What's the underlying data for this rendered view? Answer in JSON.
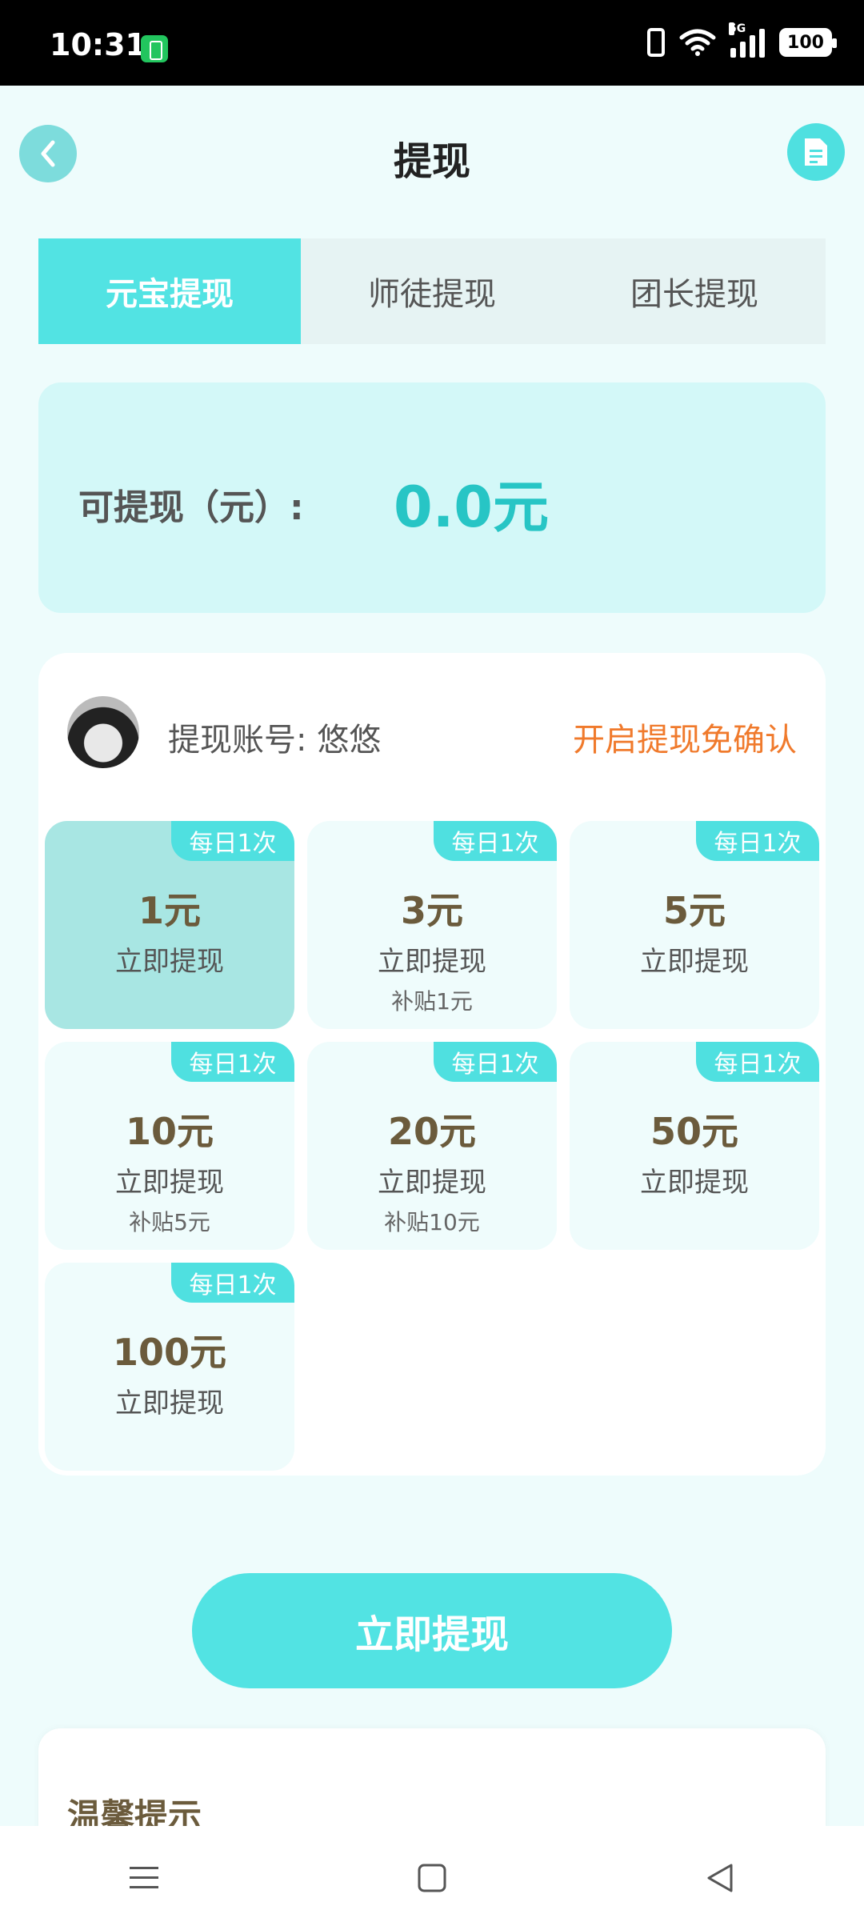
{
  "status_bar": {
    "time": "10:31",
    "network": "5G",
    "battery": "100"
  },
  "header": {
    "title": "提现"
  },
  "tabs": [
    {
      "label": "元宝提现",
      "active": true
    },
    {
      "label": "师徒提现",
      "active": false
    },
    {
      "label": "团长提现",
      "active": false
    }
  ],
  "balance": {
    "label": "可提现（元）:",
    "value": "0.0元"
  },
  "account": {
    "label": "提现账号: 悠悠",
    "auto_confirm_link": "开启提现免确认"
  },
  "amount_options": [
    {
      "badge": "每日1次",
      "amount": "1元",
      "action": "立即提现",
      "subsidy": "",
      "selected": true
    },
    {
      "badge": "每日1次",
      "amount": "3元",
      "action": "立即提现",
      "subsidy": "补贴1元",
      "selected": false
    },
    {
      "badge": "每日1次",
      "amount": "5元",
      "action": "立即提现",
      "subsidy": "",
      "selected": false
    },
    {
      "badge": "每日1次",
      "amount": "10元",
      "action": "立即提现",
      "subsidy": "补贴5元",
      "selected": false
    },
    {
      "badge": "每日1次",
      "amount": "20元",
      "action": "立即提现",
      "subsidy": "补贴10元",
      "selected": false
    },
    {
      "badge": "每日1次",
      "amount": "50元",
      "action": "立即提现",
      "subsidy": "",
      "selected": false
    },
    {
      "badge": "每日1次",
      "amount": "100元",
      "action": "立即提现",
      "subsidy": "",
      "selected": false
    }
  ],
  "withdraw_button": {
    "label": "立即提现"
  },
  "tips": {
    "title": "温馨提示"
  },
  "colors": {
    "accent": "#52e3e3",
    "orange": "#f07a2c",
    "amount_text": "#6b5b3c"
  }
}
